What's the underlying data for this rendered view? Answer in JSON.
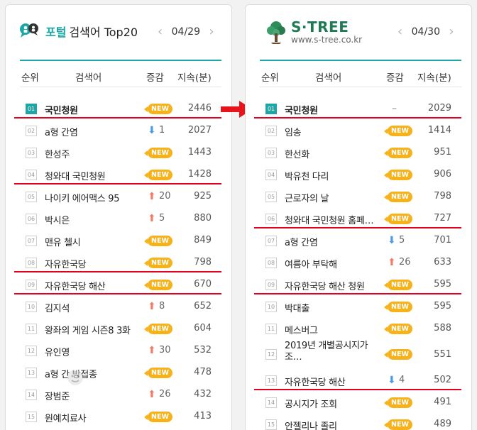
{
  "left": {
    "title_strong": "포털",
    "title_rest": "검색어 Top20",
    "date": "04/29",
    "columns": {
      "rank": "순위",
      "keyword": "검색어",
      "change": "증감",
      "duration": "지속(분)"
    },
    "items": [
      {
        "rank": "01",
        "keyword": "국민청원",
        "change": {
          "type": "new",
          "label": "NEW"
        },
        "duration": "2446"
      },
      {
        "rank": "02",
        "keyword": "a형 간염",
        "change": {
          "type": "down",
          "value": "1"
        },
        "duration": "2027"
      },
      {
        "rank": "03",
        "keyword": "한성주",
        "change": {
          "type": "new",
          "label": "NEW"
        },
        "duration": "1443"
      },
      {
        "rank": "04",
        "keyword": "청와대 국민청원",
        "change": {
          "type": "new",
          "label": "NEW"
        },
        "duration": "1428"
      },
      {
        "rank": "05",
        "keyword": "나이키 에어맥스 95",
        "change": {
          "type": "up",
          "value": "20"
        },
        "duration": "925"
      },
      {
        "rank": "06",
        "keyword": "박시은",
        "change": {
          "type": "up",
          "value": "5"
        },
        "duration": "880"
      },
      {
        "rank": "07",
        "keyword": "맨유 첼시",
        "change": {
          "type": "new",
          "label": "NEW"
        },
        "duration": "849"
      },
      {
        "rank": "08",
        "keyword": "자유한국당",
        "change": {
          "type": "new",
          "label": "NEW"
        },
        "duration": "798"
      },
      {
        "rank": "09",
        "keyword": "자유한국당 해산",
        "change": {
          "type": "new",
          "label": "NEW"
        },
        "duration": "670"
      },
      {
        "rank": "10",
        "keyword": "김지석",
        "change": {
          "type": "up",
          "value": "8"
        },
        "duration": "652"
      },
      {
        "rank": "11",
        "keyword": "왕좌의 게임 시즌8 3화",
        "change": {
          "type": "new",
          "label": "NEW"
        },
        "duration": "604"
      },
      {
        "rank": "12",
        "keyword": "유인영",
        "change": {
          "type": "up",
          "value": "30"
        },
        "duration": "532"
      },
      {
        "rank": "13",
        "keyword": "a형 간   방접종",
        "change": {
          "type": "new",
          "label": "NEW"
        },
        "duration": "478"
      },
      {
        "rank": "14",
        "keyword": "장범준",
        "change": {
          "type": "up",
          "value": "26"
        },
        "duration": "432"
      },
      {
        "rank": "15",
        "keyword": "원예치료사",
        "change": {
          "type": "new",
          "label": "NEW"
        },
        "duration": "413"
      }
    ]
  },
  "right": {
    "logo_name": "S·TREE",
    "logo_url": "www.s-tree.co.kr",
    "date": "04/30",
    "columns": {
      "rank": "순위",
      "keyword": "검색어",
      "change": "증감",
      "duration": "지속(분)"
    },
    "items": [
      {
        "rank": "01",
        "keyword": "국민청원",
        "change": {
          "type": "same",
          "label": "–"
        },
        "duration": "2029"
      },
      {
        "rank": "02",
        "keyword": "임송",
        "change": {
          "type": "new",
          "label": "NEW"
        },
        "duration": "1414"
      },
      {
        "rank": "03",
        "keyword": "한선화",
        "change": {
          "type": "new",
          "label": "NEW"
        },
        "duration": "951"
      },
      {
        "rank": "04",
        "keyword": "박유천 다리",
        "change": {
          "type": "new",
          "label": "NEW"
        },
        "duration": "906"
      },
      {
        "rank": "05",
        "keyword": "근로자의 날",
        "change": {
          "type": "new",
          "label": "NEW"
        },
        "duration": "798"
      },
      {
        "rank": "06",
        "keyword": "청와대 국민청원 홈페…",
        "change": {
          "type": "new",
          "label": "NEW"
        },
        "duration": "727"
      },
      {
        "rank": "07",
        "keyword": "a형 간염",
        "change": {
          "type": "down",
          "value": "5"
        },
        "duration": "701"
      },
      {
        "rank": "08",
        "keyword": "여름아 부탁해",
        "change": {
          "type": "up",
          "value": "26"
        },
        "duration": "633"
      },
      {
        "rank": "09",
        "keyword": "자유한국당 해산 청원",
        "change": {
          "type": "new",
          "label": "NEW"
        },
        "duration": "595"
      },
      {
        "rank": "10",
        "keyword": "박대출",
        "change": {
          "type": "new",
          "label": "NEW"
        },
        "duration": "595"
      },
      {
        "rank": "11",
        "keyword": "메스버그",
        "change": {
          "type": "new",
          "label": "NEW"
        },
        "duration": "588"
      },
      {
        "rank": "12",
        "keyword": "2019년 개별공시지가 조…",
        "change": {
          "type": "new",
          "label": "NEW"
        },
        "duration": "551"
      },
      {
        "rank": "13",
        "keyword": "자유한국당 해산",
        "change": {
          "type": "down",
          "value": "4"
        },
        "duration": "502"
      },
      {
        "rank": "14",
        "keyword": "공시지가 조회",
        "change": {
          "type": "new",
          "label": "NEW"
        },
        "duration": "491"
      },
      {
        "rank": "15",
        "keyword": "안젤리나 졸리",
        "change": {
          "type": "new",
          "label": "NEW"
        },
        "duration": "489"
      }
    ]
  },
  "colors": {
    "accent": "#1ea7a7",
    "new_badge": "#f7b21a",
    "up": "#f37a67",
    "down": "#4d9ae6",
    "highlight_line": "#e6001f"
  }
}
